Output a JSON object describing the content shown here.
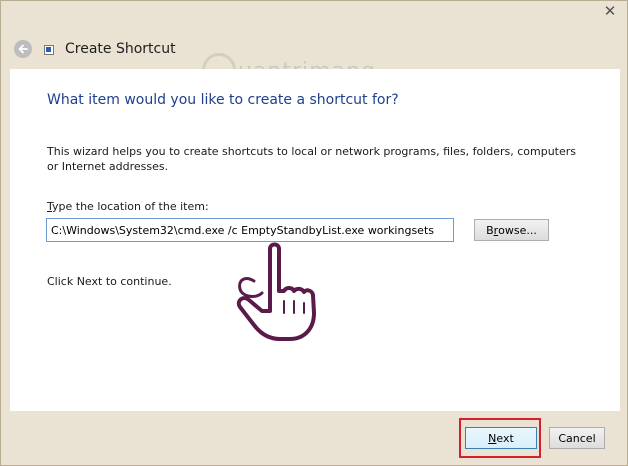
{
  "window": {
    "close_glyph": "✕"
  },
  "header": {
    "back_glyph": "←",
    "title": "Create Shortcut"
  },
  "watermark": {
    "text": "uantrimang"
  },
  "content": {
    "heading": "What item would you like to create a shortcut for?",
    "description": "This wizard helps you to create shortcuts to local or network programs, files, folders, computers or Internet addresses.",
    "location_label_accel": "T",
    "location_label_rest": "ype the location of the item:",
    "location_value": "C:\\Windows\\System32\\cmd.exe /c EmptyStandbyList.exe workingsets",
    "browse_accel": "r",
    "browse_pre": "B",
    "browse_post": "owse...",
    "continue_text": "Click Next to continue."
  },
  "footer": {
    "next_accel": "N",
    "next_rest": "ext",
    "cancel_label": "Cancel"
  },
  "colors": {
    "heading": "#1f3f8f",
    "highlight": "#d7202f",
    "frame": "#eae3d4"
  }
}
